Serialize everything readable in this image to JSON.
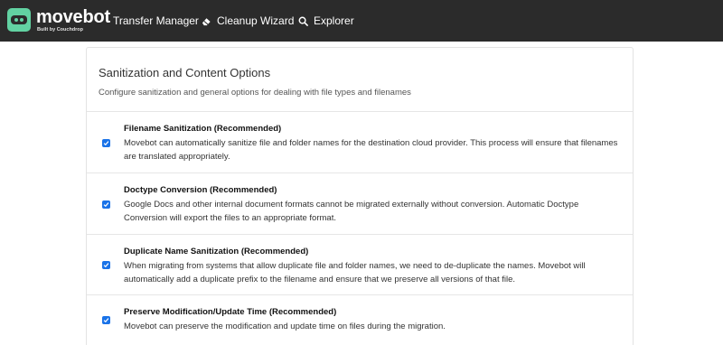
{
  "app": {
    "brand": "movebot",
    "brand_sub": "Built by Couchdrop",
    "accent": "#62d2a2"
  },
  "nav": [
    {
      "label": "Transfer Manager",
      "icon": "none"
    },
    {
      "label": "Cleanup Wizard",
      "icon": "eraser-icon"
    },
    {
      "label": "Explorer",
      "icon": "search-icon"
    }
  ],
  "section": {
    "title": "Sanitization and Content Options",
    "subtitle": "Configure sanitization and general options for dealing with file types and filenames"
  },
  "options": [
    {
      "title": "Filename Sanitization (Recommended)",
      "description": "Movebot can automatically sanitize file and folder names for the destination cloud provider. This process will ensure that filenames are translated appropriately.",
      "checked": true
    },
    {
      "title": "Doctype Conversion (Recommended)",
      "description": "Google Docs and other internal document formats cannot be migrated externally without conversion. Automatic Doctype Conversion will export the files to an appropriate format.",
      "checked": true
    },
    {
      "title": "Duplicate Name Sanitization (Recommended)",
      "description": "When migrating from systems that allow duplicate file and folder names, we need to de-duplicate the names. Movebot will automatically add a duplicate prefix to the filename and ensure that we preserve all versions of that file.",
      "checked": true
    },
    {
      "title": "Preserve Modification/Update Time (Recommended)",
      "description": "Movebot can preserve the modification and update time on files during the migration.",
      "checked": true
    }
  ],
  "colors": {
    "topbar": "#2b2b2b",
    "checkbox": "#1a73e8"
  }
}
